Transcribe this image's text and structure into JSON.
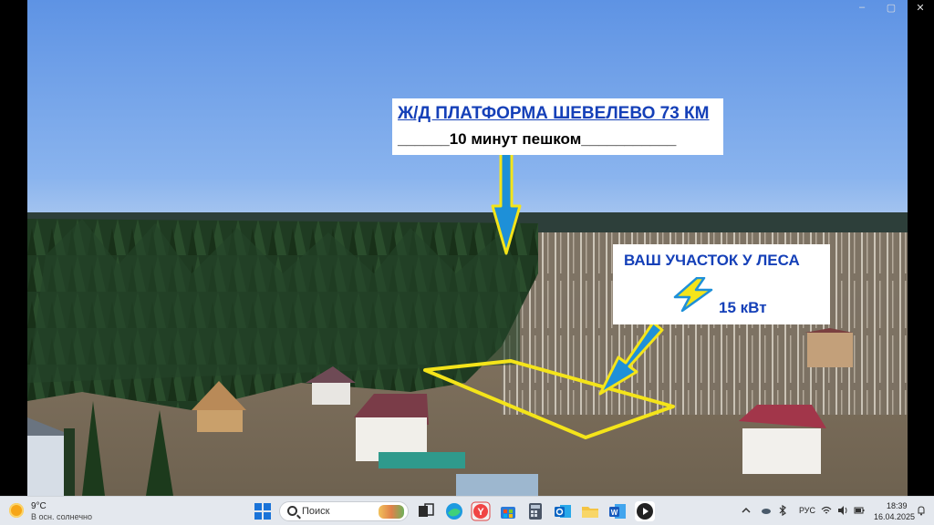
{
  "window": {
    "controls": [
      "–",
      "▢",
      "✕"
    ]
  },
  "photo": {
    "platform_label": {
      "title": "Ж/Д ПЛАТФОРМА ШЕВЕЛЕВО 73 КМ",
      "subtitle": "______10 минут пешком___________"
    },
    "plot_label": {
      "title": "ВАШ УЧАСТОК У ЛЕСА",
      "power": "15 кВт"
    },
    "colors": {
      "arrow_fill": "#1e90d8",
      "arrow_outline": "#f4e41a",
      "plot_outline": "#f4e41a",
      "bolt_fill": "#f4e41a",
      "bolt_outline": "#1e90d8",
      "label_text": "#1540b8"
    }
  },
  "taskbar": {
    "weather": {
      "icon": "sun-cloud-icon",
      "temperature": "9°C",
      "description": "В осн. солнечно"
    },
    "search": {
      "label": "Поиск",
      "icon": "search-icon"
    },
    "apps": [
      {
        "name": "start-button",
        "icon": "windows-logo-icon"
      },
      {
        "name": "task-view",
        "icon": "task-view-icon"
      },
      {
        "name": "edge",
        "icon": "edge-icon"
      },
      {
        "name": "yandex-browser",
        "icon": "yandex-icon"
      },
      {
        "name": "store",
        "icon": "store-icon"
      },
      {
        "name": "calculator",
        "icon": "calculator-icon"
      },
      {
        "name": "outlook",
        "icon": "outlook-icon"
      },
      {
        "name": "file-explorer",
        "icon": "folder-icon"
      },
      {
        "name": "word",
        "icon": "word-icon"
      },
      {
        "name": "media-player",
        "icon": "media-player-icon"
      }
    ],
    "tray": {
      "language": "РУС",
      "time": "18:39",
      "date": "16.04.2025"
    }
  }
}
